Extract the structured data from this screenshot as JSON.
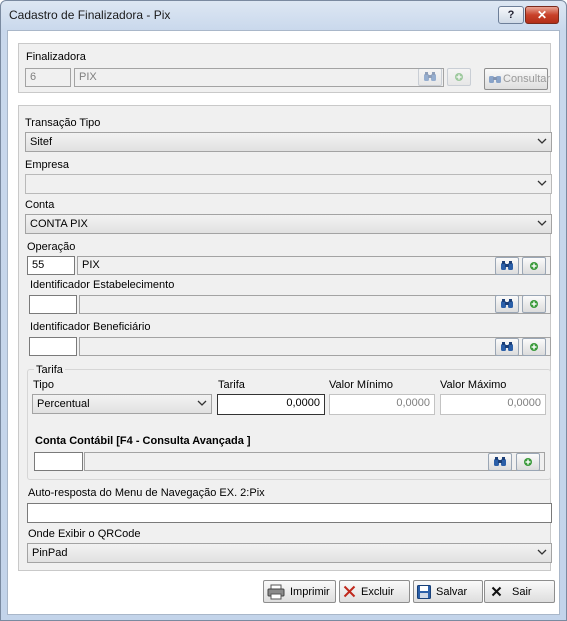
{
  "window": {
    "title": "Cadastro de Finalizadora - Pix",
    "help_label": "?",
    "close_label": "✕"
  },
  "finalizadora": {
    "label": "Finalizadora",
    "code": "6",
    "name": "PIX",
    "consultar_label": "Consultar"
  },
  "transacao_tipo": {
    "label": "Transação Tipo",
    "value": "Sitef"
  },
  "empresa": {
    "label": "Empresa",
    "value": ""
  },
  "conta": {
    "label": "Conta",
    "value": "CONTA PIX"
  },
  "operacao": {
    "label": "Operação",
    "code": "55",
    "name": "PIX"
  },
  "id_estabelecimento": {
    "label": "Identificador Estabelecimento",
    "code": "",
    "name": ""
  },
  "id_beneficiario": {
    "label": "Identificador Beneficiário",
    "code": "",
    "name": ""
  },
  "tarifa": {
    "group_label": "Tarifa",
    "tipo_label": "Tipo",
    "tipo_value": "Percentual",
    "tarifa_label": "Tarifa",
    "tarifa_value": "0,0000",
    "minimo_label": "Valor Mínimo",
    "minimo_value": "0,0000",
    "maximo_label": "Valor Máximo",
    "maximo_value": "0,0000",
    "conta_contabil_label": "Conta Contábil [F4 - Consulta Avançada ]",
    "conta_contabil_code": "",
    "conta_contabil_name": ""
  },
  "auto_resposta": {
    "label": "Auto-resposta do Menu de Navegação EX. 2:Pix",
    "value": ""
  },
  "qrcode": {
    "label": "Onde Exibir o QRCode",
    "value": "PinPad"
  },
  "buttons": {
    "imprimir": "Imprimir",
    "excluir": "Excluir",
    "salvar": "Salvar",
    "sair": "Sair"
  },
  "colors": {
    "accent_blue": "#2b5fa8",
    "add_green": "#3a9a3a",
    "delete_red": "#c0281c"
  }
}
